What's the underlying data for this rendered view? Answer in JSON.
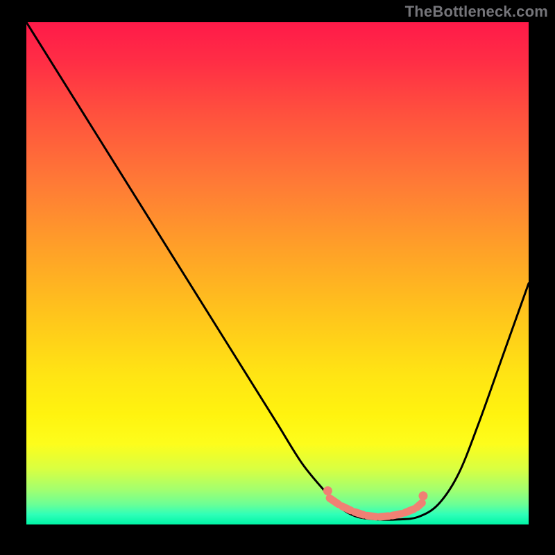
{
  "watermark": "TheBottleneck.com",
  "chart_data": {
    "type": "line",
    "title": "",
    "xlabel": "",
    "ylabel": "",
    "xlim": [
      0,
      100
    ],
    "ylim": [
      0,
      100
    ],
    "note": "Values are read from the rendered curve in percent of plot width (x) and percent of plot height measured from bottom (y). Color gradient maps y to bottleneck severity (green=low, red=high).",
    "series": [
      {
        "name": "bottleneck-curve",
        "x": [
          0,
          5,
          10,
          15,
          20,
          25,
          30,
          35,
          40,
          45,
          50,
          55,
          60,
          63,
          66,
          70,
          74,
          78,
          82,
          86,
          90,
          95,
          100
        ],
        "y": [
          100,
          92,
          84,
          76,
          68,
          60,
          52,
          44,
          36,
          28,
          20,
          12,
          6,
          3,
          1.5,
          1,
          1,
          1.5,
          4,
          10,
          20,
          34,
          48
        ]
      }
    ],
    "markers": {
      "name": "highlight-band",
      "color": "#f08074",
      "points_x": [
        60,
        62.5,
        65,
        67.5,
        70,
        72.5,
        75,
        77.5,
        79
      ],
      "points_y": [
        5.5,
        3.8,
        2.6,
        1.8,
        1.5,
        1.7,
        2.2,
        3.2,
        4.5
      ]
    },
    "gradient_stops": [
      {
        "pos": 0.0,
        "color": "#ff1a49"
      },
      {
        "pos": 0.32,
        "color": "#ff7a36"
      },
      {
        "pos": 0.58,
        "color": "#ffc41c"
      },
      {
        "pos": 0.84,
        "color": "#fdfd1c"
      },
      {
        "pos": 1.0,
        "color": "#00f5a6"
      }
    ]
  }
}
